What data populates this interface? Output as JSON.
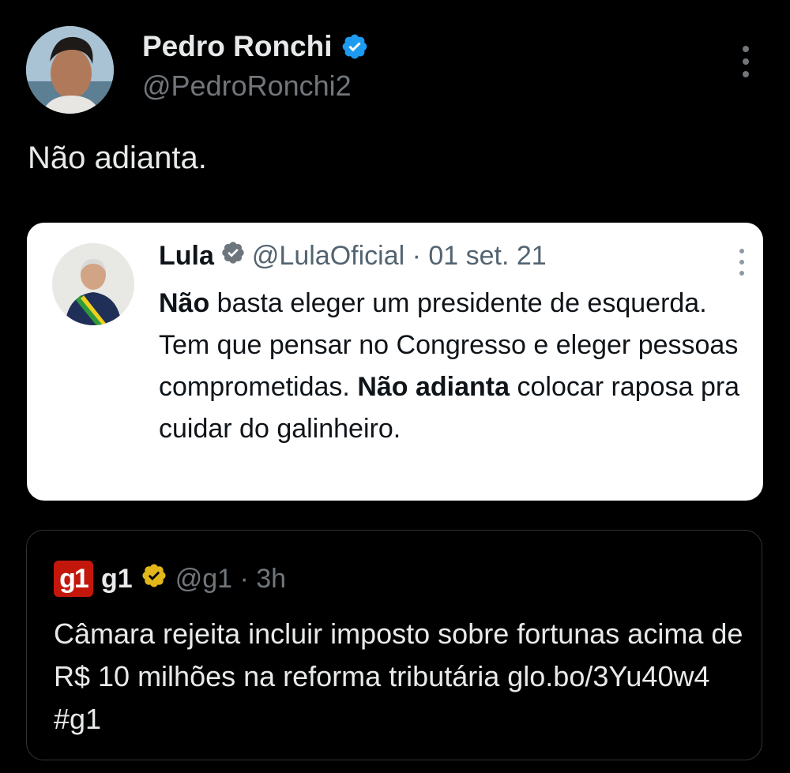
{
  "tweet": {
    "author_name": "Pedro Ronchi",
    "author_handle": "@PedroRonchi2",
    "text": "Não adianta."
  },
  "quoted_screenshot": {
    "author_name": "Lula",
    "meta": "@LulaOficial · 01 set. 21",
    "body_bold_1": "Não",
    "body_part_1": " basta eleger um presidente de esquerda. Tem que pensar no Congresso e eleger pessoas comprometidas. ",
    "body_bold_2": "Não adianta",
    "body_part_2": " colocar raposa pra cuidar do galinheiro."
  },
  "embedded_tweet": {
    "logo_text": "g1",
    "author_name": "g1",
    "meta": "@g1 · 3h",
    "body": "Câmara rejeita incluir imposto sobre fortunas acima de R$ 10 milhões na reforma tributária glo.bo/3Yu40w4 #g1"
  },
  "icons": {
    "verified_blue": "verified-badge-icon",
    "verified_gray": "verified-badge-icon",
    "verified_gold": "verified-org-badge-icon",
    "more": "more-options-icon"
  },
  "colors": {
    "background": "#000000",
    "verified_blue": "#1d9bf0",
    "verified_gold": "#e2b719",
    "g1_brand": "#c4170c",
    "secondary_text": "#71767b"
  }
}
